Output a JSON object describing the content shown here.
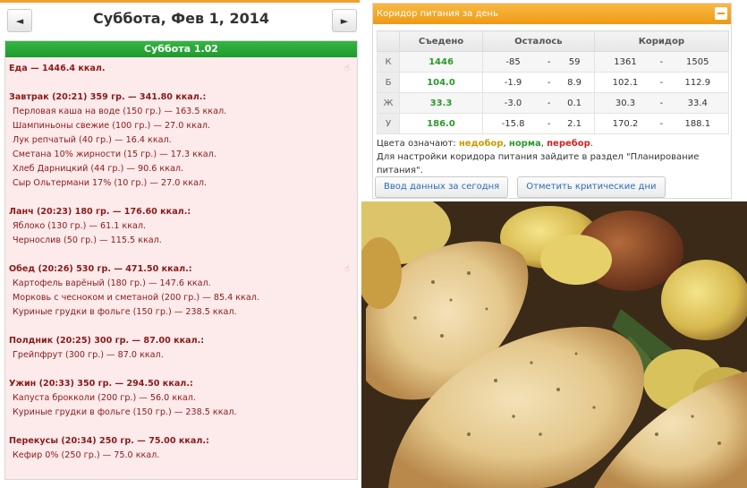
{
  "date_nav": {
    "prev_icon": "◄",
    "title": "Суббота, Фев 1, 2014",
    "next_icon": "►"
  },
  "day": {
    "header": "Суббота 1.02",
    "total": "Еда — 1446.4 ккал.",
    "meals": [
      {
        "title": "Завтрак (20:21) 359 гр. — 341.80 ккал.:",
        "items": [
          "Перловая каша на воде (150 гр.) — 163.5 ккал.",
          "Шампиньоны свежие (100 гр.) — 27.0 ккал.",
          "Лук репчатый (40 гр.) — 16.4 ккал.",
          "Сметана 10% жирности (15 гр.) — 17.3 ккал.",
          "Хлеб Дарницкий (44 гр.) — 90.6 ккал.",
          "Сыр Ольтермани 17% (10 гр.) — 27.0 ккал."
        ]
      },
      {
        "title": "Ланч (20:23) 180 гр. — 176.60 ккал.:",
        "items": [
          "Яблоко (130 гр.) — 61.1 ккал.",
          "Чернослив (50 гр.) — 115.5 ккал."
        ]
      },
      {
        "title": "Обед (20:26) 530 гр. — 471.50 ккал.:",
        "items": [
          "Картофель варёный (180 гр.) — 147.6 ккал.",
          "Морковь с чесноком и сметаной (200 гр.) — 85.4 ккал.",
          "Куриные грудки в фольге (150 гр.) — 238.5 ккал."
        ]
      },
      {
        "title": "Полдник (20:25) 300 гр. — 87.00 ккал.:",
        "items": [
          "Грейпфрут (300 гр.) — 87.0 ккал."
        ]
      },
      {
        "title": "Ужин (20:33) 350 гр. — 294.50 ккал.:",
        "items": [
          "Капуста брокколи (200 гр.) — 56.0 ккал.",
          "Куриные грудки в фольге (150 гр.) — 238.5 ккал."
        ]
      },
      {
        "title": "Перекусы (20:34) 250 гр. — 75.00 ккал.:",
        "items": [
          "Кефир 0% (250 гр.) — 75.0 ккал."
        ]
      }
    ]
  },
  "corridor": {
    "title": "Коридор питания за день",
    "columns": [
      "Съедено",
      "Осталось",
      "Коридор"
    ],
    "rows": [
      {
        "label": "К",
        "eaten": "1446",
        "left_min": "-85",
        "left_sep": "-",
        "left_max": "59",
        "cor_min": "1361",
        "cor_sep": "-",
        "cor_max": "1505"
      },
      {
        "label": "Б",
        "eaten": "104.0",
        "left_min": "-1.9",
        "left_sep": "-",
        "left_max": "8.9",
        "cor_min": "102.1",
        "cor_sep": "-",
        "cor_max": "112.9"
      },
      {
        "label": "Ж",
        "eaten": "33.3",
        "left_min": "-3.0",
        "left_sep": "-",
        "left_max": "0.1",
        "cor_min": "30.3",
        "cor_sep": "-",
        "cor_max": "33.4"
      },
      {
        "label": "У",
        "eaten": "186.0",
        "left_min": "-15.8",
        "left_sep": "-",
        "left_max": "2.1",
        "cor_min": "170.2",
        "cor_sep": "-",
        "cor_max": "188.1"
      }
    ],
    "legend_prefix": "Цвета означают:",
    "legend_under": "недобор",
    "legend_norm": "норма",
    "legend_over": "перебор",
    "note": "Для настройки коридора питания зайдите в раздел \"Планирование питания\".",
    "btn_today": "Ввод данных за сегодня",
    "btn_critical": "Отметить критические дни"
  },
  "colors": {
    "accent": "#ee9a14",
    "green": "#2a9a2a",
    "header_green": "#1e9a2d",
    "text_red": "#8b1a1a"
  },
  "icons": {
    "prev": "arrow-left-icon",
    "next": "arrow-right-icon",
    "minimize": "minimize-icon",
    "hand": "hand-pointer-icon"
  }
}
